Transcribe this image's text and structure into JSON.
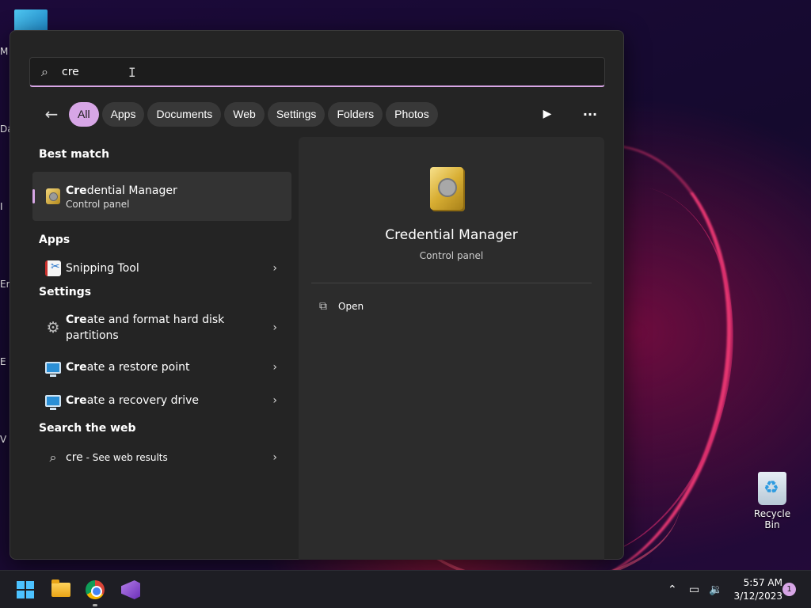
{
  "desktop": {
    "edge_letters": [
      "M",
      "Da",
      "I",
      "Er",
      "E",
      "V"
    ],
    "recycle_bin_label": "Recycle Bin"
  },
  "search": {
    "query": "cre",
    "icon": "search-icon"
  },
  "filters": [
    {
      "label": "All",
      "active": true
    },
    {
      "label": "Apps"
    },
    {
      "label": "Documents"
    },
    {
      "label": "Web"
    },
    {
      "label": "Settings"
    },
    {
      "label": "Folders"
    },
    {
      "label": "Photos"
    }
  ],
  "results": {
    "best_match_heading": "Best match",
    "best_match": {
      "bold": "Cre",
      "rest": "dential Manager",
      "sub": "Control panel"
    },
    "apps_heading": "Apps",
    "apps": [
      {
        "label": "Snipping Tool"
      }
    ],
    "settings_heading": "Settings",
    "settings": [
      {
        "bold": "Cre",
        "rest_line1": "ate and format hard disk",
        "line2": "partitions"
      },
      {
        "bold": "Cre",
        "rest": "ate a restore point"
      },
      {
        "bold": "Cre",
        "rest": "ate a recovery drive"
      }
    ],
    "web_heading": "Search the web",
    "web": {
      "query": "cre",
      "suffix": " - See web results"
    }
  },
  "preview": {
    "title": "Credential Manager",
    "subtitle": "Control panel",
    "actions": [
      {
        "label": "Open",
        "icon": "open-external-icon"
      }
    ]
  },
  "taskbar": {
    "time": "5:57 AM",
    "date": "3/12/2023",
    "notification_count": "1"
  },
  "colors": {
    "accent": "#d7a6e6",
    "panel_bg": "#242424",
    "preview_bg": "#2c2c2c"
  }
}
